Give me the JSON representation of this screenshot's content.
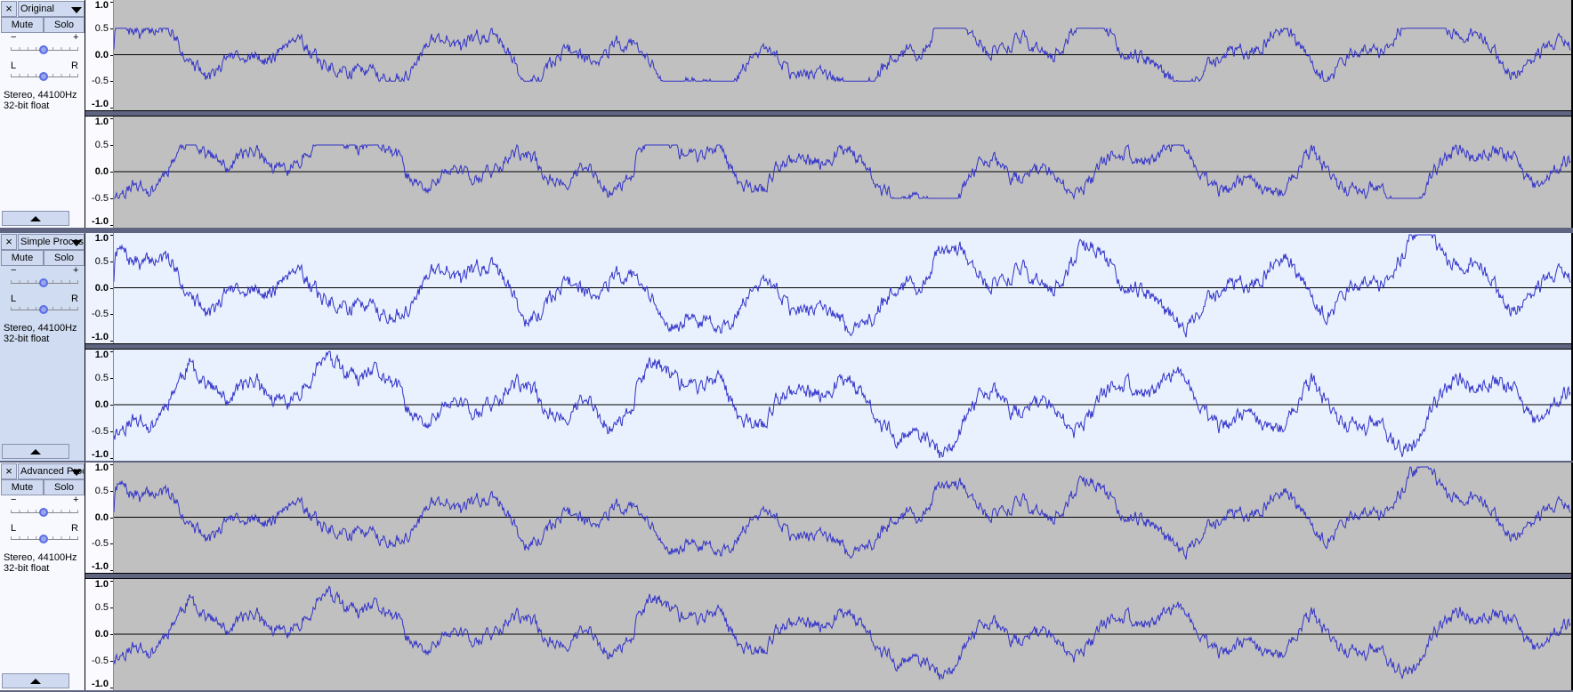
{
  "colors": {
    "waveform": "#3232c8",
    "background": "#c0c0c0",
    "selected_background": "#e8f1fd",
    "panel_selected": "#cfdcf1"
  },
  "common": {
    "close_icon": "×",
    "mute": "Mute",
    "solo": "Solo",
    "gain_minus": "−",
    "gain_plus": "+",
    "pan_left": "L",
    "pan_right": "R"
  },
  "ruler_labels": [
    "1.0",
    "0.5",
    "0.0",
    "-0.5",
    "-1.0"
  ],
  "tracks": [
    {
      "name": "Original",
      "info1": "Stereo, 44100Hz",
      "info2": "32-bit float",
      "selected": false
    },
    {
      "name": "Simple Processing",
      "info1": "Stereo, 44100Hz",
      "info2": "32-bit float",
      "selected": true
    },
    {
      "name": "Advanced Processing",
      "info1": "Stereo, 44100Hz",
      "info2": "32-bit float",
      "selected": false
    }
  ]
}
